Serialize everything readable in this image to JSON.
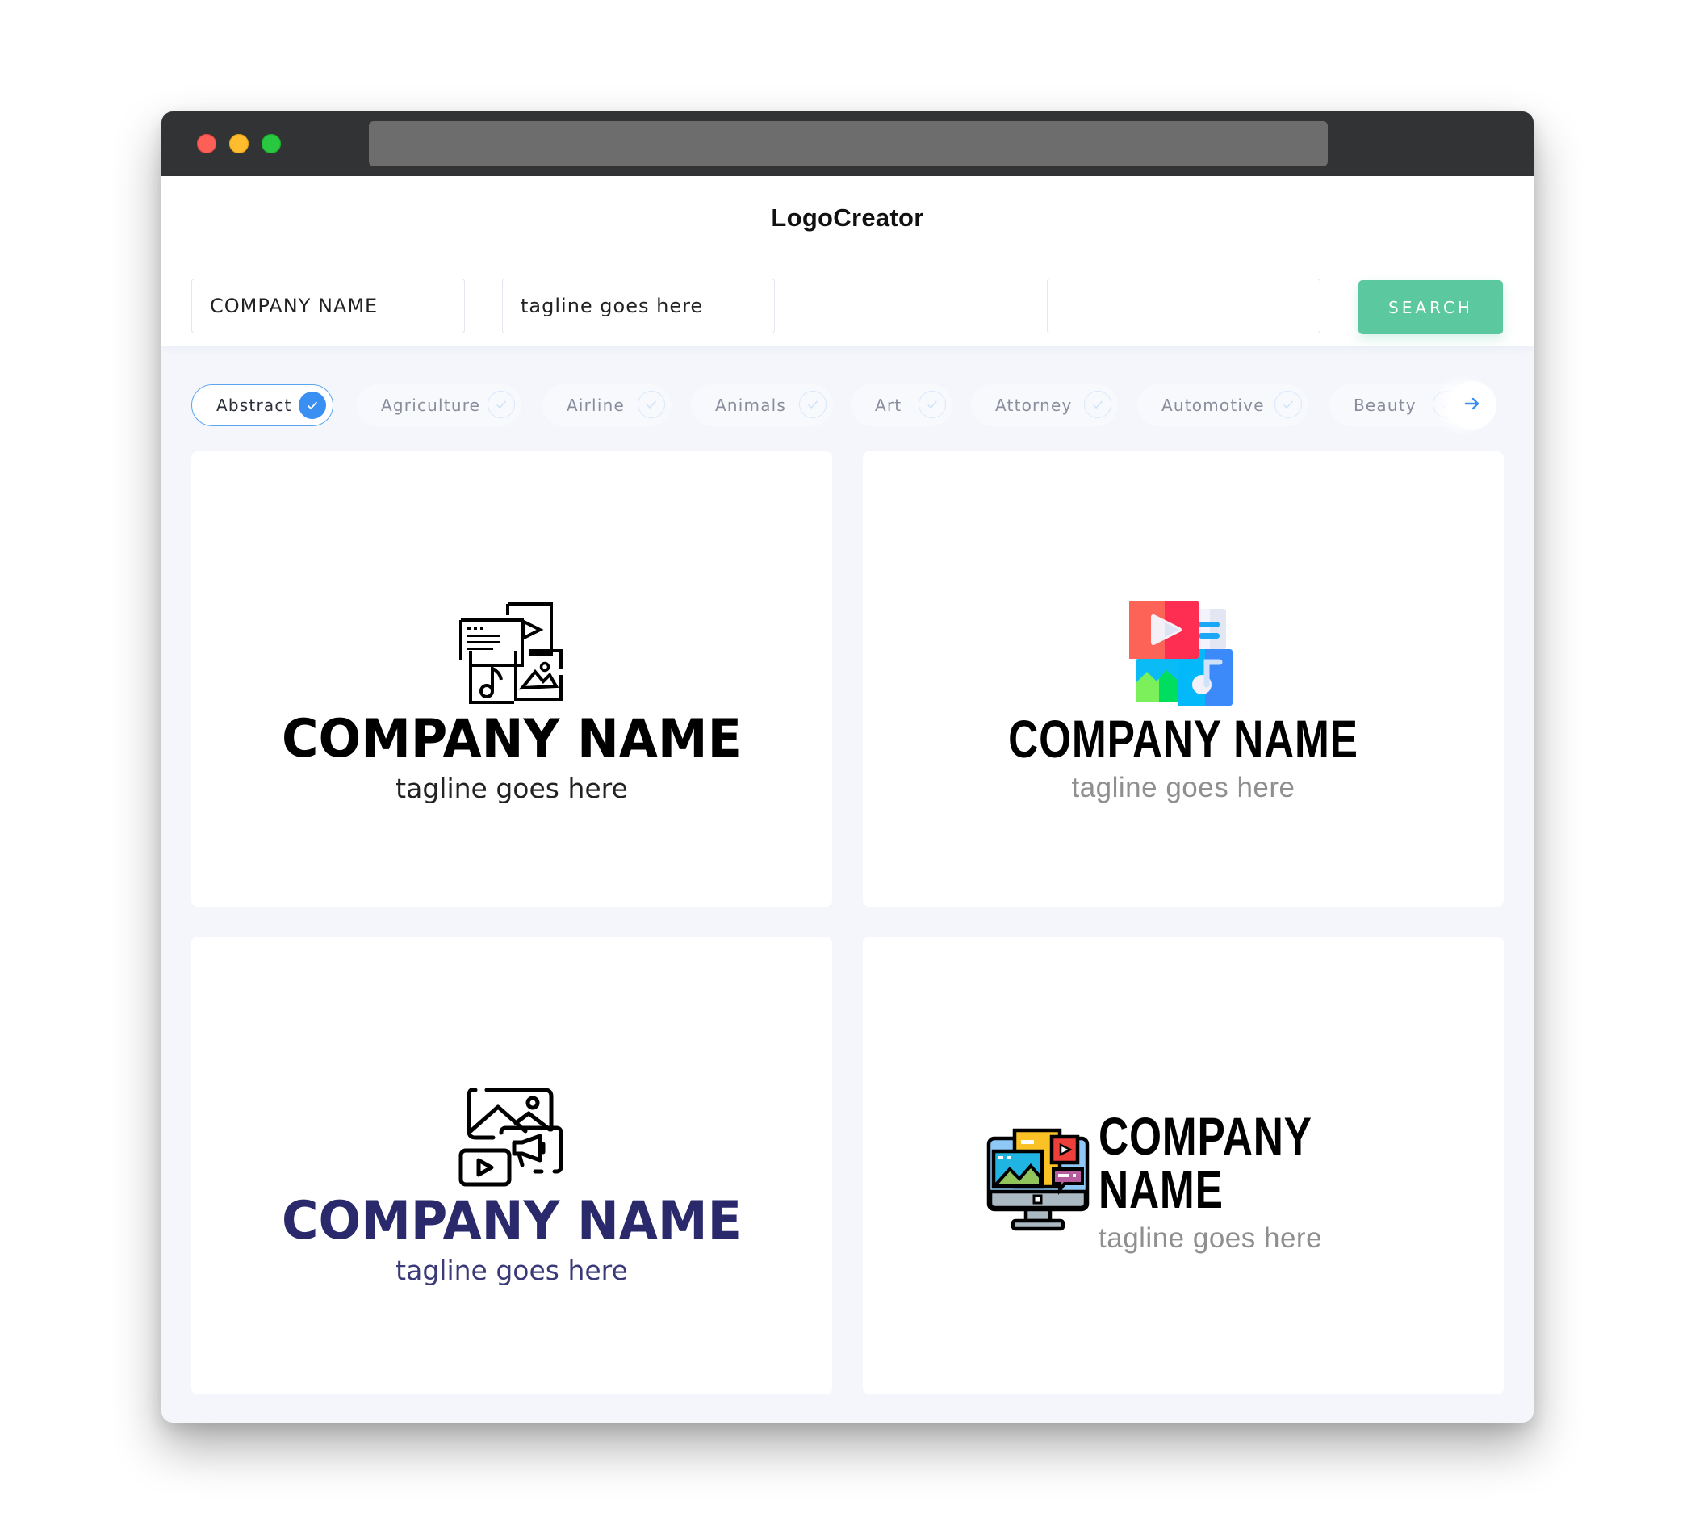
{
  "window": {
    "controls": [
      "close",
      "minimize",
      "maximize"
    ],
    "url": ""
  },
  "header": {
    "title": "LogoCreator"
  },
  "search": {
    "company_value": "COMPANY NAME",
    "tagline_value": "tagline goes here",
    "extra_value": "",
    "button_label": "SEARCH"
  },
  "categories": {
    "items": [
      {
        "label": "Abstract",
        "selected": true
      },
      {
        "label": "Agriculture",
        "selected": false
      },
      {
        "label": "Airline",
        "selected": false
      },
      {
        "label": "Animals",
        "selected": false
      },
      {
        "label": "Art",
        "selected": false
      },
      {
        "label": "Attorney",
        "selected": false
      },
      {
        "label": "Automotive",
        "selected": false
      },
      {
        "label": "Beauty",
        "selected": false
      }
    ],
    "next_icon": "arrow-right-icon"
  },
  "colors": {
    "accent_green": "#5bc89f",
    "accent_blue": "#3a8ff3",
    "navy_text": "#29296b",
    "titlebar": "#323335"
  },
  "logos": [
    {
      "icon": "media-files-outline-icon",
      "company": "COMPANY NAME",
      "tagline": "tagline goes here",
      "color": "#000000",
      "tagline_color": "#222222"
    },
    {
      "icon": "media-files-flat-color-icon",
      "company": "COMPANY NAME",
      "tagline": "tagline goes here",
      "color": "#000000",
      "tagline_color": "#8f8f8f"
    },
    {
      "icon": "media-marketing-outline-icon",
      "company": "COMPANY NAME",
      "tagline": "tagline goes here",
      "color": "#29296b",
      "tagline_color": "#3a3a78"
    },
    {
      "icon": "monitor-media-color-icon",
      "company": "COMPANY NAME",
      "tagline": "tagline goes here",
      "color": "#000000",
      "tagline_color": "#8f8f8f"
    }
  ]
}
